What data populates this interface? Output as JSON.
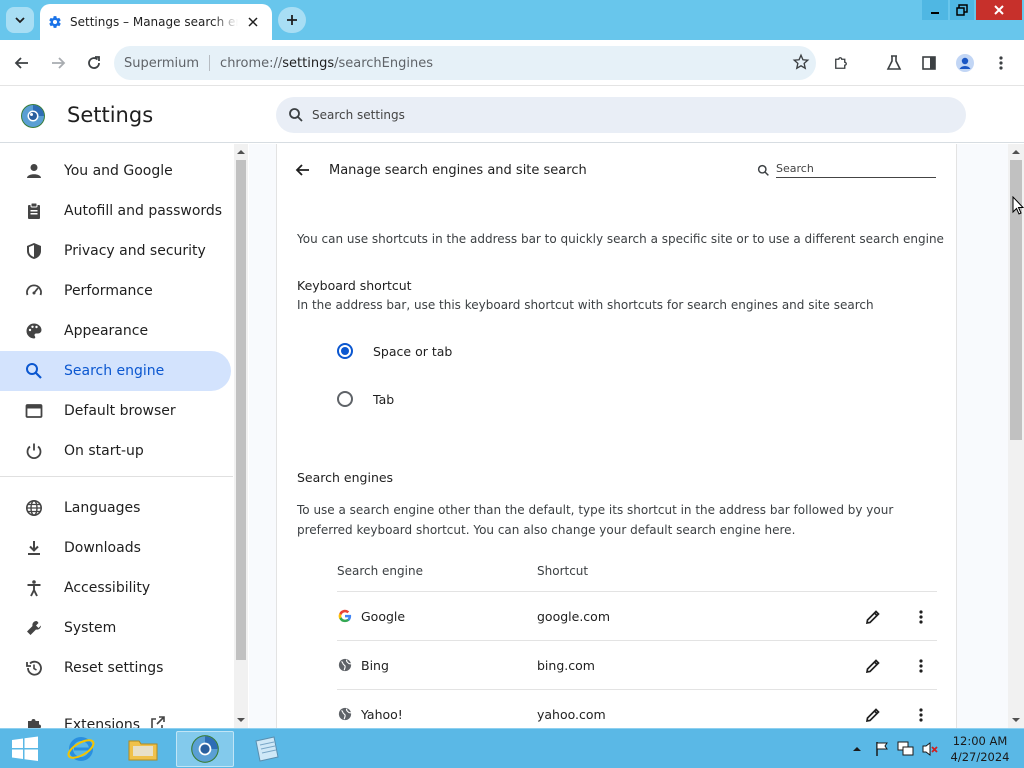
{
  "browser": {
    "tab_title": "Settings – Manage search engines",
    "omnibox": {
      "site_label": "Supermium",
      "url_scheme": "chrome://",
      "url_host": "settings",
      "url_path": "/searchEngines"
    }
  },
  "settings": {
    "title": "Settings",
    "search_placeholder": "Search settings"
  },
  "sidebar": {
    "items": [
      {
        "label": "You and Google",
        "icon": "person-icon"
      },
      {
        "label": "Autofill and passwords",
        "icon": "clipboard-icon"
      },
      {
        "label": "Privacy and security",
        "icon": "shield-icon"
      },
      {
        "label": "Performance",
        "icon": "speedometer-icon"
      },
      {
        "label": "Appearance",
        "icon": "palette-icon"
      },
      {
        "label": "Search engine",
        "icon": "search-icon",
        "active": true
      },
      {
        "label": "Default browser",
        "icon": "browser-window-icon"
      },
      {
        "label": "On start-up",
        "icon": "power-icon"
      },
      {
        "label": "Languages",
        "icon": "globe-icon"
      },
      {
        "label": "Downloads",
        "icon": "download-icon"
      },
      {
        "label": "Accessibility",
        "icon": "accessibility-icon"
      },
      {
        "label": "System",
        "icon": "wrench-icon"
      },
      {
        "label": "Reset settings",
        "icon": "history-icon"
      },
      {
        "label": "Extensions",
        "icon": "puzzle-icon"
      }
    ]
  },
  "page": {
    "title": "Manage search engines and site search",
    "search_placeholder": "Search",
    "description": "You can use shortcuts in the address bar to quickly search a specific site or to use a different search engine",
    "keyboard_shortcut": {
      "title": "Keyboard shortcut",
      "subtitle": "In the address bar, use this keyboard shortcut with shortcuts for search engines and site search",
      "options": [
        {
          "label": "Space or tab",
          "checked": true
        },
        {
          "label": "Tab",
          "checked": false
        }
      ]
    },
    "search_engines": {
      "title": "Search engines",
      "description": "To use a search engine other than the default, type its shortcut in the address bar followed by your preferred keyboard shortcut. You can also change your default search engine here.",
      "columns": [
        "Search engine",
        "Shortcut"
      ],
      "rows": [
        {
          "name": "Google",
          "shortcut": "google.com",
          "icon": "google-g-icon"
        },
        {
          "name": "Bing",
          "shortcut": "bing.com",
          "icon": "globe-icon"
        },
        {
          "name": "Yahoo!",
          "shortcut": "yahoo.com",
          "icon": "globe-icon"
        }
      ]
    }
  },
  "taskbar": {
    "time": "12:00 AM",
    "date": "4/27/2024"
  },
  "colors": {
    "titlebar": "#68c6ec",
    "accent": "#0b57d0",
    "active_nav": "#d3e3fd",
    "taskbar": "#5ab8e6",
    "close_button": "#c7302b"
  }
}
